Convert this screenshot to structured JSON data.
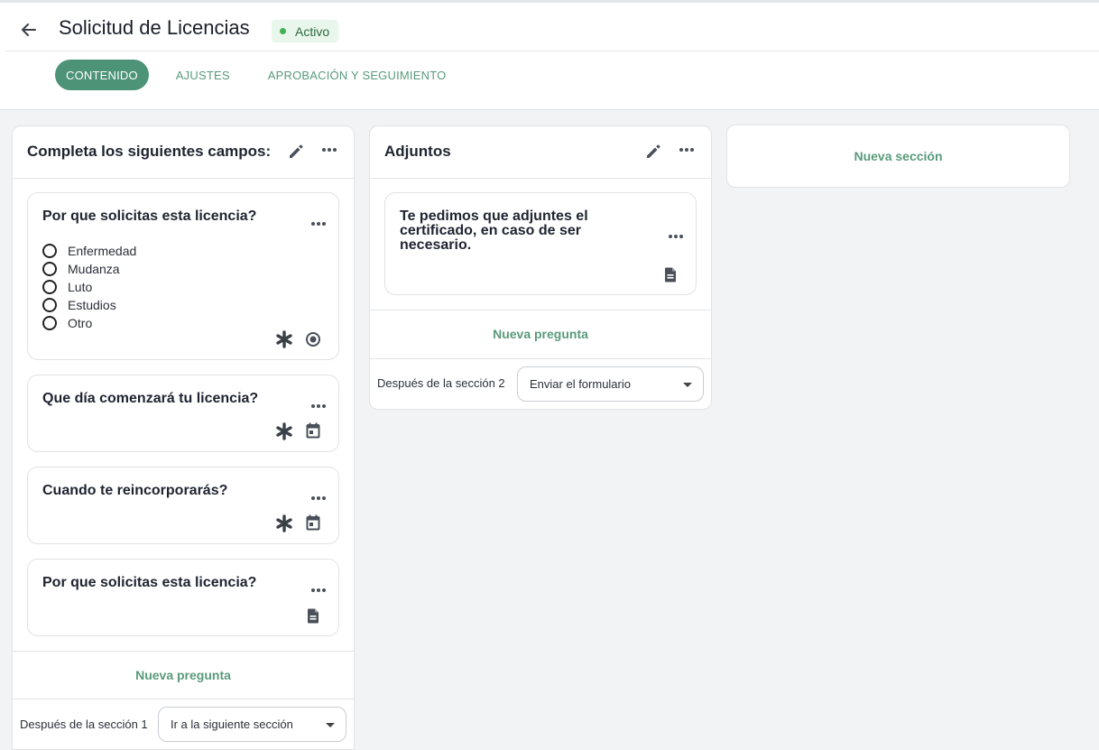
{
  "header": {
    "title": "Solicitud de Licencias",
    "status": "Activo",
    "tabs": [
      "CONTENIDO",
      "AJUSTES",
      "APROBACIÓN Y SEGUIMIENTO"
    ]
  },
  "sections": [
    {
      "title": "Completa los siguientes campos:",
      "questions": [
        {
          "title": "Por que solicitas esta licencia?",
          "options": [
            "Enfermedad",
            "Mudanza",
            "Luto",
            "Estudios",
            "Otro"
          ],
          "required_icon": "asterisk-icon",
          "type_icon": "radio-icon"
        },
        {
          "title": "Que día comenzará tu licencia?",
          "required_icon": "asterisk-icon",
          "type_icon": "calendar-icon"
        },
        {
          "title": "Cuando te reincorporarás?",
          "required_icon": "asterisk-icon",
          "type_icon": "calendar-icon"
        },
        {
          "title": "Por que solicitas esta licencia?",
          "type_icon": "document-icon"
        }
      ],
      "new_question": "Nueva pregunta",
      "after_label": "Después de la sección 1",
      "after_value": "Ir a la siguiente sección"
    },
    {
      "title": "Adjuntos",
      "questions": [
        {
          "title": "Te pedimos que adjuntes el certificado, en caso de ser necesario.",
          "type_icon": "document-icon"
        }
      ],
      "new_question": "Nueva pregunta",
      "after_label": "Después de la sección 2",
      "after_value": "Enviar el formulario"
    }
  ],
  "new_section": "Nueva sección",
  "colors": {
    "accent": "#4d9378",
    "accent_text": "#5a9a7b",
    "status_dot": "#3fb353"
  }
}
